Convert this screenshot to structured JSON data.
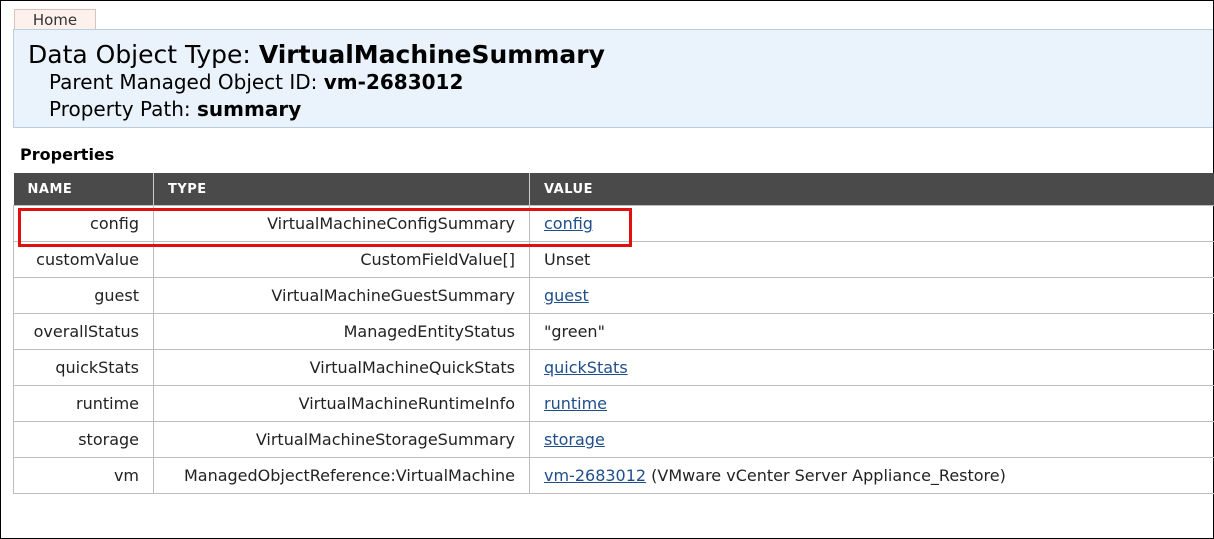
{
  "nav": {
    "home_label": "Home"
  },
  "header": {
    "title_prefix": "Data Object Type: ",
    "title_value": "VirtualMachineSummary",
    "parent_prefix": "Parent Managed Object ID: ",
    "parent_value": "vm-2683012",
    "path_prefix": "Property Path: ",
    "path_value": "summary"
  },
  "properties": {
    "heading": "Properties",
    "columns": [
      "NAME",
      "TYPE",
      "VALUE"
    ],
    "rows": [
      {
        "name": "config",
        "type": "VirtualMachineConfigSummary",
        "value_link": "config",
        "value_text": ""
      },
      {
        "name": "customValue",
        "type": "CustomFieldValue[]",
        "value_link": "",
        "value_text": "Unset"
      },
      {
        "name": "guest",
        "type": "VirtualMachineGuestSummary",
        "value_link": "guest",
        "value_text": ""
      },
      {
        "name": "overallStatus",
        "type": "ManagedEntityStatus",
        "value_link": "",
        "value_text": "\"green\""
      },
      {
        "name": "quickStats",
        "type": "VirtualMachineQuickStats",
        "value_link": "quickStats",
        "value_text": ""
      },
      {
        "name": "runtime",
        "type": "VirtualMachineRuntimeInfo",
        "value_link": "runtime",
        "value_text": ""
      },
      {
        "name": "storage",
        "type": "VirtualMachineStorageSummary",
        "value_link": "storage",
        "value_text": ""
      },
      {
        "name": "vm",
        "type": "ManagedObjectReference:VirtualMachine",
        "value_link": "vm-2683012",
        "value_text": " (VMware vCenter Server Appliance_Restore)"
      }
    ]
  },
  "colors": {
    "highlight": "#e01010",
    "link": "#1f4e8c",
    "header_bg": "#eaf3fb",
    "table_header_bg": "#4a4a4a"
  }
}
